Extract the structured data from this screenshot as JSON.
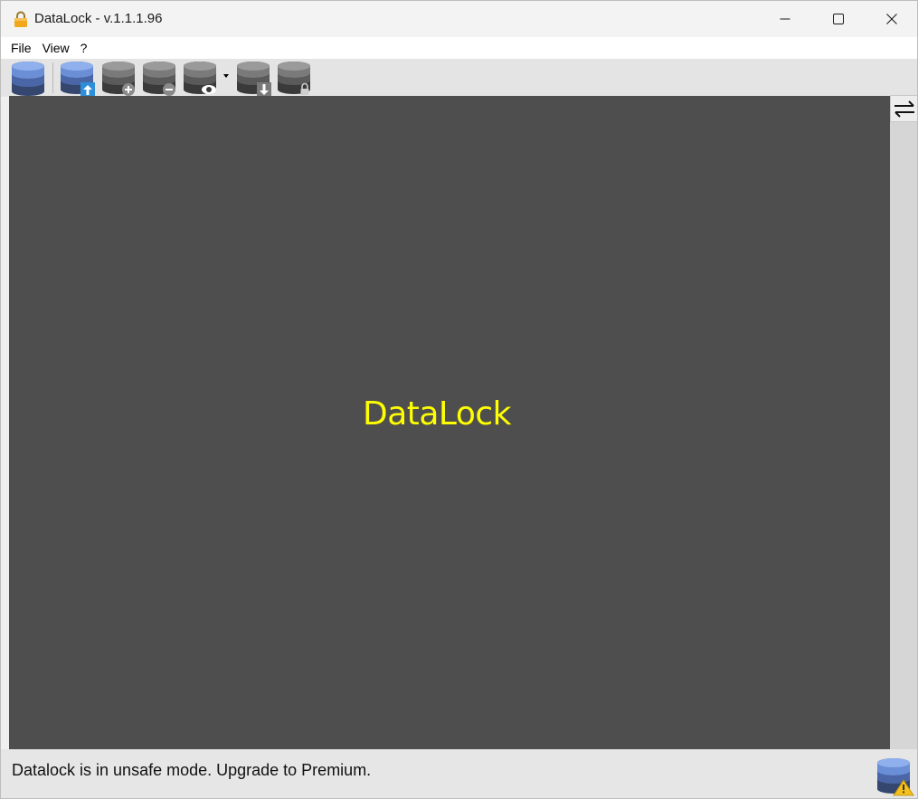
{
  "window": {
    "title": "DataLock - v.1.1.1.96"
  },
  "menu": {
    "items": [
      "File",
      "View",
      "?"
    ]
  },
  "toolbar": {
    "buttons": [
      {
        "name": "database-icon",
        "color": "#5b7fc4"
      },
      {
        "name": "database-upload-icon",
        "color": "#5b7fc4"
      },
      {
        "name": "database-add-icon",
        "color": "#6a6a6a"
      },
      {
        "name": "database-remove-icon",
        "color": "#6a6a6a"
      },
      {
        "name": "database-view-icon",
        "color": "#6a6a6a"
      },
      {
        "name": "database-download-icon",
        "color": "#6a6a6a"
      },
      {
        "name": "database-lock-icon",
        "color": "#6a6a6a"
      }
    ]
  },
  "main": {
    "brand": "DataLock",
    "brand_color": "#ffff00",
    "background": "#4e4e4e"
  },
  "statusbar": {
    "message": "Datalock is in unsafe mode. Upgrade to Premium."
  }
}
